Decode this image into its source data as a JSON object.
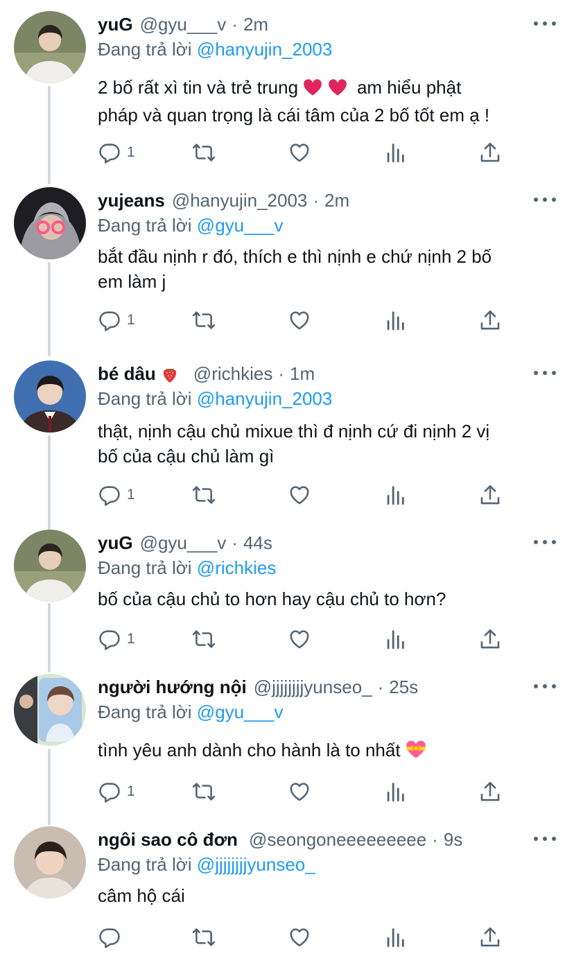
{
  "colors": {
    "text": "#0f1419",
    "muted": "#536471",
    "link": "#1d9bf0",
    "thread": "#cfd9de"
  },
  "reply_prefix": "Đang trả lời",
  "tweets": [
    {
      "name": "yuG",
      "handle": "@gyu___v",
      "time": "2m",
      "reply_to": "@hanyujin_2003",
      "body_line1": "2 bố rất xì tin và trẻ trung",
      "body_line1b": "am hiểu phật",
      "body_line2": "pháp và quan trọng là cái tâm của 2 bố tốt em ạ !",
      "reply_count": "1",
      "avatar": "boy-white-shirt-avatar"
    },
    {
      "name": "yujeans",
      "handle": "@hanyujin_2003",
      "time": "2m",
      "reply_to": "@gyu___v",
      "body_line1": "bắt đầu nịnh r đó, thích e thì nịnh e chứ nịnh 2 bố",
      "body_line2": "em làm j",
      "reply_count": "1",
      "avatar": "hoodie-heart-glasses-avatar"
    },
    {
      "name": "bé dâu",
      "handle": "@richkies",
      "time": "1m",
      "reply_to": "@hanyujin_2003",
      "body_line1": "thật, nịnh cậu chủ mixue thì đ nịnh cứ đi nịnh 2 vị",
      "body_line2": "bố của cậu chủ làm gì",
      "reply_count": "1",
      "avatar": "school-uniform-avatar"
    },
    {
      "name": "yuG",
      "handle": "@gyu___v",
      "time": "44s",
      "reply_to": "@richkies",
      "body_line1": "bố của cậu chủ to hơn hay cậu chủ to hơn?",
      "reply_count": "1",
      "avatar": "boy-white-shirt-avatar"
    },
    {
      "name": "người hướng nội",
      "handle": "@jjjjjjjjyunseo_",
      "time": "25s",
      "reply_to": "@gyu___v",
      "body_line1": "tình yêu anh dành cho hành là to nhất",
      "reply_count": "1",
      "avatar": "photo-collage-avatar"
    },
    {
      "name": "ngôi sao cô đơn",
      "handle": "@seongoneeeeeeeee",
      "time": "9s",
      "reply_to": "@jjjjjjjjyunseo_",
      "body_line1": "câm hộ cái",
      "reply_count": "",
      "avatar": "boy-portrait-avatar"
    }
  ]
}
